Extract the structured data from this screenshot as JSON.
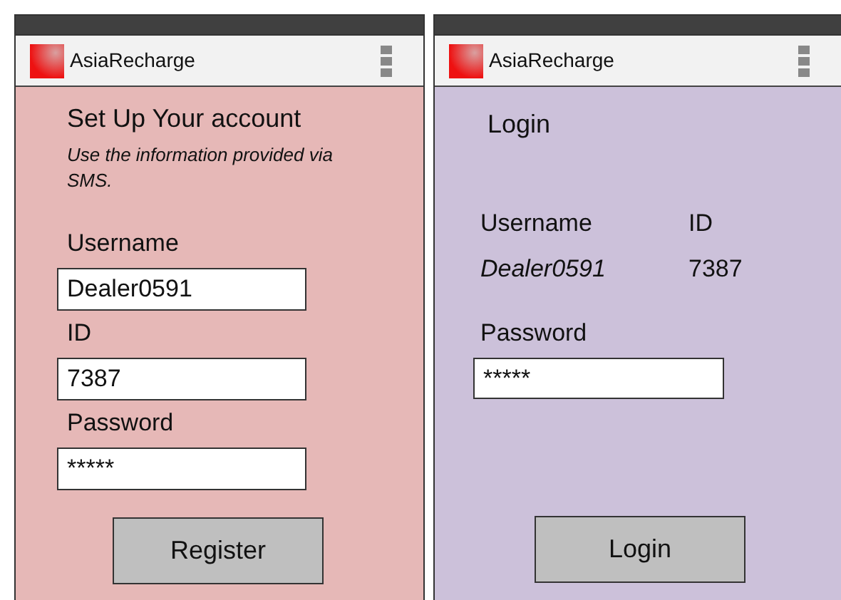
{
  "screens": [
    {
      "kind": "register",
      "app_bar": {
        "title": "AsiaRecharge"
      },
      "heading": "Set Up Your account",
      "subtitle": "Use the information provided via SMS.",
      "fields": [
        {
          "label": "Username",
          "value": "Dealer0591"
        },
        {
          "label": "ID",
          "value": "7387"
        },
        {
          "label": "Password",
          "value": "*****"
        }
      ],
      "button": "Register"
    },
    {
      "kind": "login",
      "app_bar": {
        "title": "AsiaRecharge"
      },
      "heading": "Login",
      "details": [
        {
          "label": "Username",
          "value": "Dealer0591"
        },
        {
          "label": "ID",
          "value": "7387"
        }
      ],
      "fields": [
        {
          "label": "Password",
          "value": "*****"
        }
      ],
      "button": "Login"
    }
  ]
}
